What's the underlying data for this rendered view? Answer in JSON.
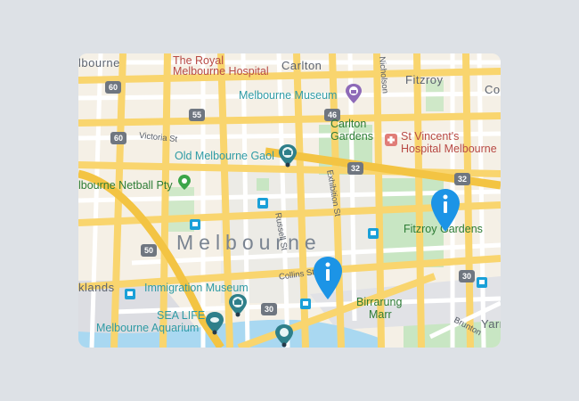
{
  "map": {
    "suburbs": {
      "carlton": "Carlton",
      "fitzroy": "Fitzroy",
      "melbourne": "Melbourne",
      "docklands": "klands",
      "west_melbourne": "lbourne",
      "collingwood": "Co",
      "yarra": "Yarr"
    },
    "places": {
      "royal_hospital_line1": "The Royal",
      "royal_hospital_line2": "Melbourne Hospital",
      "museum": "Melbourne Museum",
      "carlton_gardens_line1": "Carlton",
      "carlton_gardens_line2": "Gardens",
      "st_vincents_line1": "St Vincent's",
      "st_vincents_line2": "Hospital Melbourne",
      "gaol": "Old Melbourne Gaol",
      "netball": "lbourne Netball Pty",
      "fitzroy_gardens": "Fitzroy Gardens",
      "immigration_museum": "Immigration Museum",
      "sea_life_line1": "SEA LIFE",
      "sea_life_line2": "Melbourne Aquarium",
      "birrarung_line1": "Birrarung",
      "birrarung_line2": "Marr"
    },
    "streets": {
      "victoria": "Victoria St",
      "russell": "Russell St",
      "exhibition": "Exhibition St",
      "collins": "Collins St",
      "nicholson": "Nicholson",
      "brunton": "Brunton"
    },
    "route_shields": {
      "r60": "60",
      "r55": "55",
      "r46": "46",
      "r32a": "32",
      "r32b": "32",
      "r50": "50",
      "r30a": "30",
      "r30b": "30",
      "r60b": "60"
    },
    "icons": {
      "museum": "museum-icon",
      "gaol": "landmark-icon",
      "hospital": "hospital-icon",
      "park": "park-icon",
      "immigration": "landmark-icon",
      "aquarium": "aquarium-icon",
      "attraction": "attraction-icon",
      "station": "train-station-icon",
      "info_marker": "info-marker-icon"
    },
    "colors": {
      "major_road": "#f9d56e",
      "minor_road": "#ffffff",
      "park": "#c8e6c3",
      "water": "#a9d8f1",
      "marker": "#1c94e6"
    }
  }
}
